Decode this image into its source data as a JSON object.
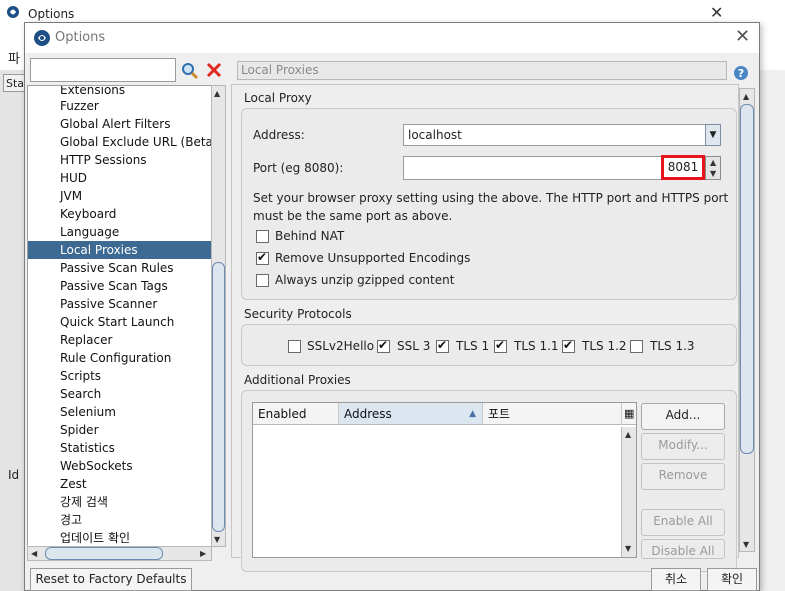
{
  "background_window": {
    "title": "Options",
    "menu_fragment": "파",
    "toolbar_fragment": "Sta",
    "list_column_fragment": "Id"
  },
  "dialog": {
    "title": "Options",
    "search": {
      "value": "",
      "placeholder": ""
    },
    "tree": {
      "selected": "Local Proxies",
      "items": [
        "Extensions",
        "Fuzzer",
        "Global Alert Filters",
        "Global Exclude URL (Beta)",
        "HTTP Sessions",
        "HUD",
        "JVM",
        "Keyboard",
        "Language",
        "Local Proxies",
        "Passive Scan Rules",
        "Passive Scan Tags",
        "Passive Scanner",
        "Quick Start Launch",
        "Replacer",
        "Rule Configuration",
        "Scripts",
        "Search",
        "Selenium",
        "Spider",
        "Statistics",
        "WebSockets",
        "Zest",
        "강제 검색",
        "경고",
        "업데이트 확인"
      ]
    },
    "buttons": {
      "reset": "Reset to Factory Defaults",
      "cancel": "취소",
      "ok": "확인"
    }
  },
  "panel": {
    "title": "Local Proxies",
    "local_proxy": {
      "section_title": "Local Proxy",
      "address_label": "Address:",
      "address_value": "localhost",
      "port_label": "Port (eg 8080):",
      "port_value": "8081",
      "note_line1": "Set your browser proxy setting using the above.  The HTTP port and HTTPS port",
      "note_line2": "must be the same port as above.",
      "behind_nat": {
        "label": "Behind NAT",
        "checked": false
      },
      "remove_unsupported": {
        "label": "Remove Unsupported Encodings",
        "checked": true
      },
      "always_unzip": {
        "label": "Always unzip gzipped content",
        "checked": false
      }
    },
    "security_protocols": {
      "section_title": "Security Protocols",
      "items": [
        {
          "label": "SSLv2Hello",
          "checked": false
        },
        {
          "label": "SSL 3",
          "checked": true
        },
        {
          "label": "TLS 1",
          "checked": true
        },
        {
          "label": "TLS 1.1",
          "checked": true
        },
        {
          "label": "TLS 1.2",
          "checked": true
        },
        {
          "label": "TLS 1.3",
          "checked": false
        }
      ]
    },
    "additional_proxies": {
      "section_title": "Additional Proxies",
      "columns": [
        "Enabled",
        "Address",
        "포트"
      ],
      "rows": [],
      "buttons": {
        "add": "Add...",
        "modify": "Modify...",
        "remove": "Remove",
        "enable_all": "Enable All",
        "disable_all": "Disable All"
      }
    }
  },
  "colors": {
    "selection": "#3d6a93",
    "highlight_box": "#e8141c"
  }
}
